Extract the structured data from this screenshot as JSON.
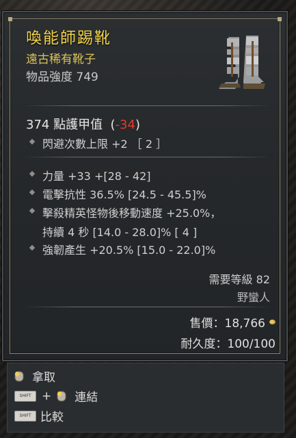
{
  "item": {
    "name": "喚能師踢靴",
    "rarity_type": "遠古稀有靴子",
    "item_power": "物品強度 749",
    "armor_value": "374 點護甲值",
    "armor_delta": "-34",
    "implicit": "閃避次數上限 +2 ［ 2 ］",
    "affixes": [
      "力量 +33 +[28 - 42]",
      "電擊抗性 36.5% [24.5 - 45.5]%",
      "擊殺精英怪物後移動速度 +25.0%，",
      "持續 4 秒 [14.0 - 28.0]% [ 4 ]",
      "強韌產生 +20.5% [15.0 - 22.0]%"
    ],
    "requirement_level": "需要等級 82",
    "requirement_class": "野蠻人",
    "sell_value": "售價：18,766",
    "durability": "耐久度：100/100",
    "icon": "boots-icon"
  },
  "actions": {
    "take": "拿取",
    "shift_label": "SHIFT",
    "plus": "+",
    "link": "連結",
    "compare": "比較"
  },
  "colors": {
    "title": "#f0d24a",
    "rarity": "#d9c25a",
    "negative": "#e03b2d",
    "text": "#cfcfcf"
  }
}
